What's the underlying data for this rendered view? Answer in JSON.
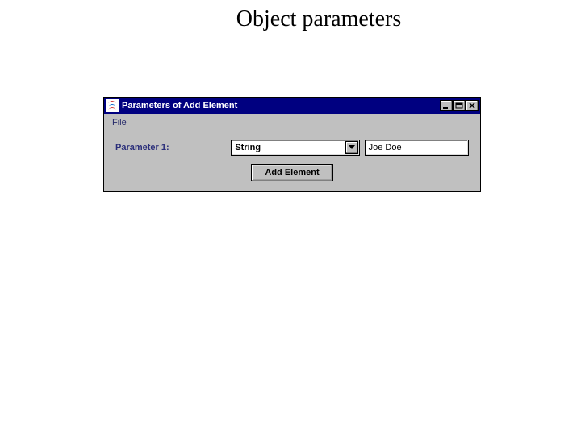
{
  "page": {
    "heading": "Object parameters"
  },
  "window": {
    "title": "Parameters of Add Element",
    "menubar": {
      "items": [
        {
          "label": "File"
        }
      ]
    },
    "form": {
      "param1": {
        "label": "Parameter 1:",
        "type_selected": "String",
        "value": "Joe Doe"
      },
      "submit_label": "Add Element"
    }
  }
}
